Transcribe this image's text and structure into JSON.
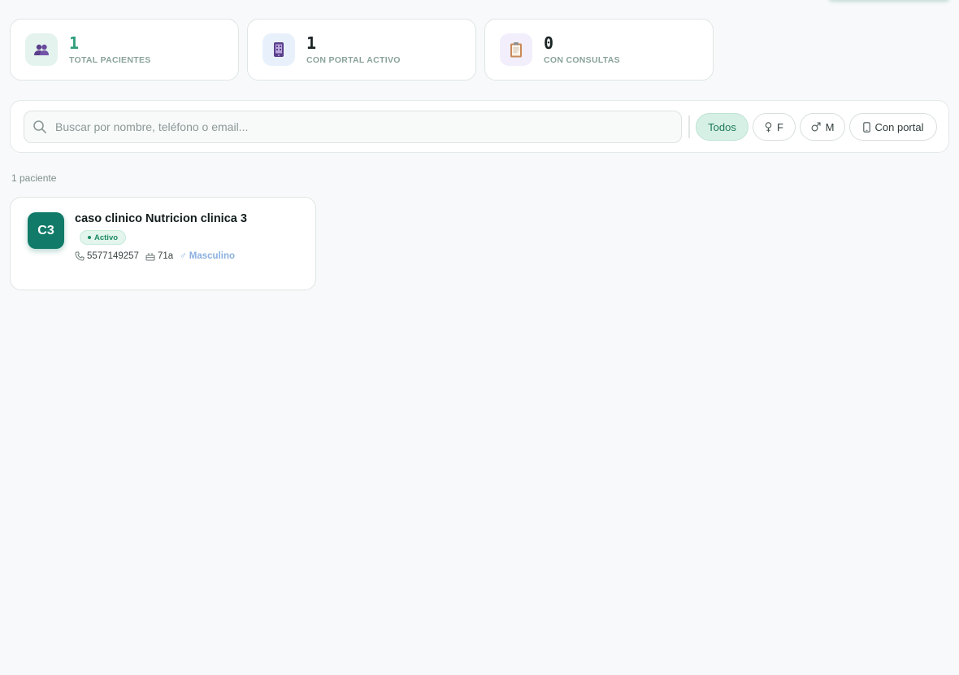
{
  "stats": [
    {
      "value": "1",
      "label": "TOTAL PACIENTES",
      "icon": "users-icon",
      "color": "#2f9d7c"
    },
    {
      "value": "1",
      "label": "CON PORTAL ACTIVO",
      "icon": "phone-icon",
      "color": "#1b2424"
    },
    {
      "value": "0",
      "label": "CON CONSULTAS",
      "icon": "clipboard-icon",
      "color": "#1b2424"
    }
  ],
  "search": {
    "placeholder": "Buscar por nombre, teléfono o email..."
  },
  "filters": [
    {
      "label": "Todos",
      "icon": "",
      "active": true
    },
    {
      "label": "F",
      "icon": "female-icon",
      "active": false
    },
    {
      "label": "M",
      "icon": "male-icon",
      "active": false
    },
    {
      "label": "Con portal",
      "icon": "phone-icon",
      "active": false
    }
  ],
  "list": {
    "count_text": "1 paciente"
  },
  "patients": [
    {
      "initials": "C3",
      "name": "caso clinico Nutricion clinica 3",
      "status": "Activo",
      "phone": "5577149257",
      "age": "71a",
      "sex": "Masculino",
      "sex_symbol": "♂"
    }
  ]
}
